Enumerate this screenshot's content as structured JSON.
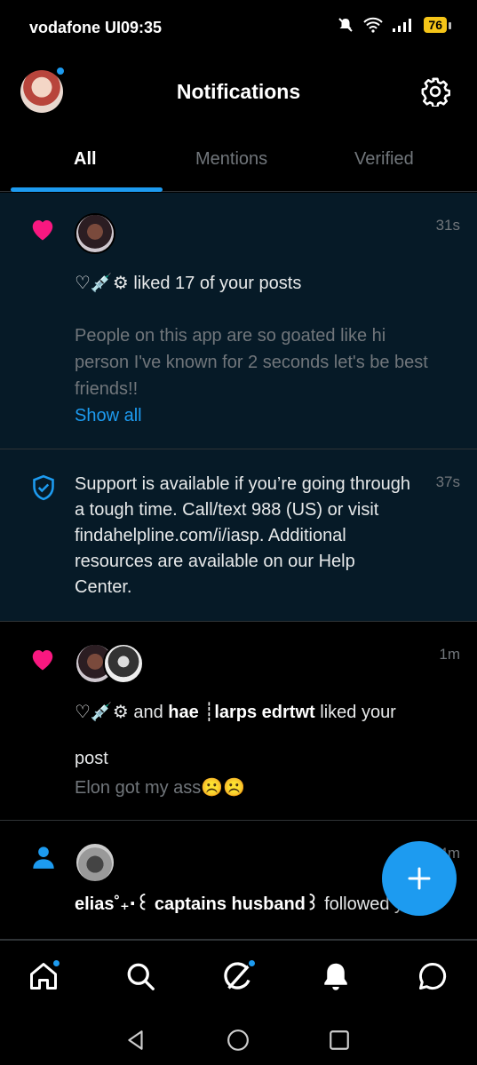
{
  "status_bar": {
    "carrier": "vodafone UI",
    "time": "09:35",
    "battery": "76"
  },
  "header": {
    "title": "Notifications"
  },
  "tabs": [
    {
      "label": "All",
      "active": true
    },
    {
      "label": "Mentions",
      "active": false
    },
    {
      "label": "Verified",
      "active": false
    }
  ],
  "notifications": [
    {
      "type": "like",
      "time": "31s",
      "actor": "♡💉⚙",
      "action": "liked 17 of your posts",
      "post_text": "People on this app are so goated like hi person I've known for 2 seconds let's be best friends!!",
      "show_all": "Show all"
    },
    {
      "type": "support",
      "time": "37s",
      "message": "Support is available if you’re going through a tough time. Call/text 988 (US) or visit findahelpline.com/i/iasp. Additional resources are available on our Help Center."
    },
    {
      "type": "like",
      "time": "1m",
      "actor": "♡💉⚙",
      "connector": "and",
      "actor2": "hae ┊larps edrtwt",
      "action": "liked your",
      "action_cont": "post",
      "post_text": "Elon got my ass☹️☹️"
    },
    {
      "type": "follow",
      "time": "4m",
      "actor": "elias˚₊‧꒰ captains husband꒱",
      "action": "followed you"
    }
  ],
  "fab": {
    "icon": "plus-icon"
  },
  "bottom_nav": [
    "home-icon",
    "search-icon",
    "grok-icon",
    "bell-icon",
    "messages-icon"
  ],
  "colors": {
    "accent": "#1d9bf0",
    "heart": "#f91880",
    "highlight_bg": "#061a27"
  }
}
